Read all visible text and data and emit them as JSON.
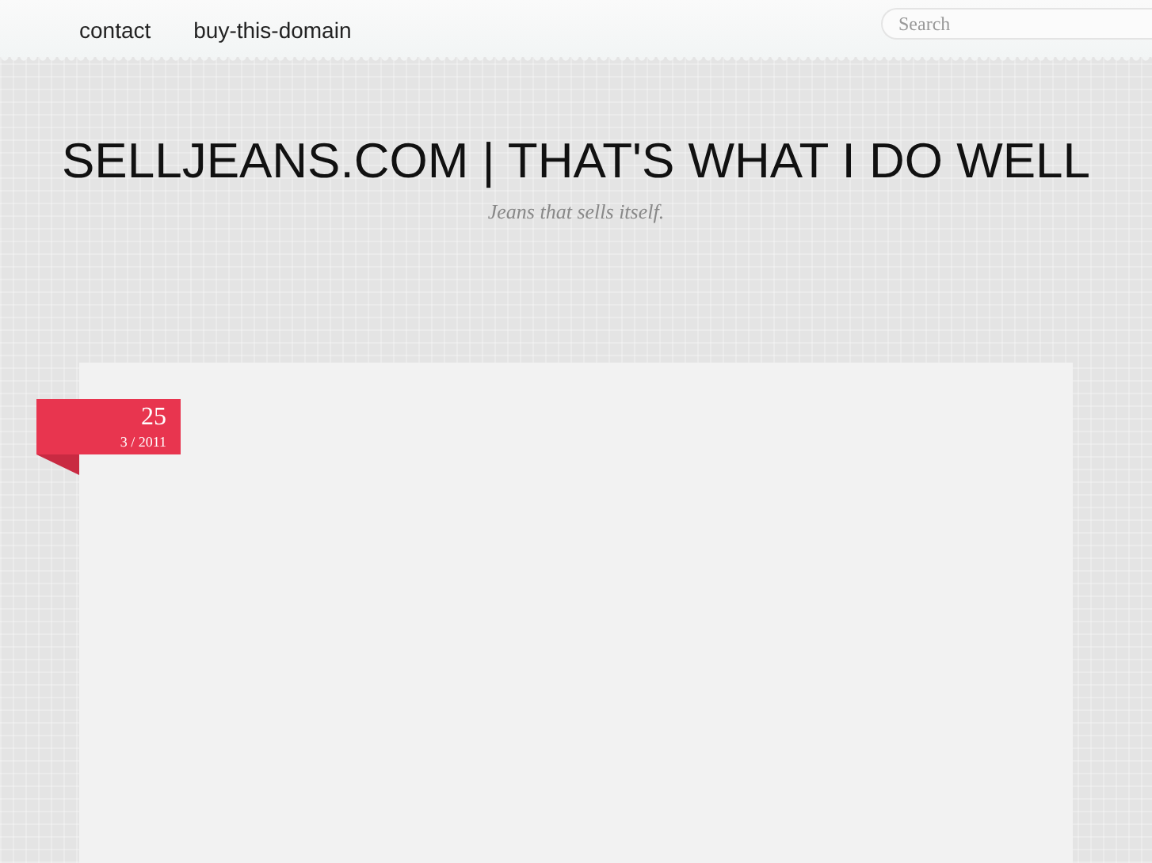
{
  "nav": {
    "links": [
      "contact",
      "buy-this-domain"
    ],
    "search": {
      "placeholder": "Search"
    }
  },
  "site": {
    "title": "SELLJEANS.COM | THAT'S WHAT I DO WELL",
    "tagline": "Jeans that sells itself."
  },
  "post": {
    "day": "25",
    "month_year": "3 / 2011"
  }
}
